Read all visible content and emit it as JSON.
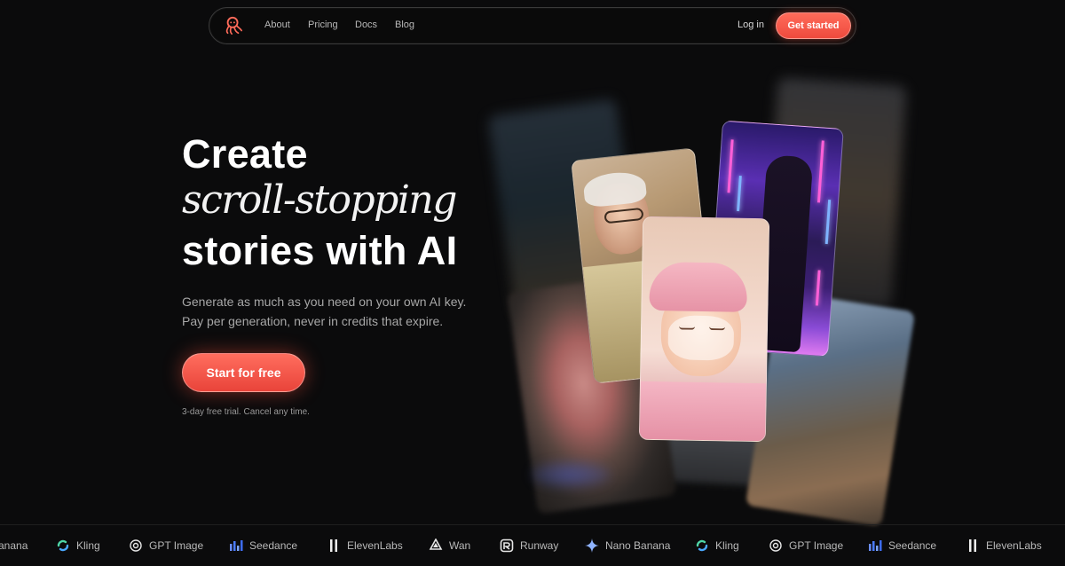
{
  "nav": {
    "links": [
      "About",
      "Pricing",
      "Docs",
      "Blog"
    ],
    "login": "Log in",
    "cta": "Get started"
  },
  "hero": {
    "line1": "Create",
    "line2": "scroll-stopping",
    "line3": "stories with AI",
    "sub1": "Generate as much as you need on your own AI key.",
    "sub2": "Pay per generation, never in credits that expire.",
    "cta": "Start for free",
    "note": "3-day free trial. Cancel any time."
  },
  "ticker": {
    "items": [
      "anana",
      "Kling",
      "GPT Image",
      "Seedance",
      "ElevenLabs",
      "Wan",
      "Runway",
      "Nano Banana",
      "Kling",
      "GPT Image",
      "Seedance",
      "ElevenLabs"
    ],
    "icons": [
      "",
      "kling-icon",
      "openai-icon",
      "seedance-icon",
      "elevenlabs-icon",
      "wan-icon",
      "runway-icon",
      "nano-banana-icon",
      "kling-icon",
      "openai-icon",
      "seedance-icon",
      "elevenlabs-icon"
    ]
  },
  "colors": {
    "background": "#0b0b0c",
    "accent": "#f0493e",
    "text_muted": "#a7a7a7"
  }
}
